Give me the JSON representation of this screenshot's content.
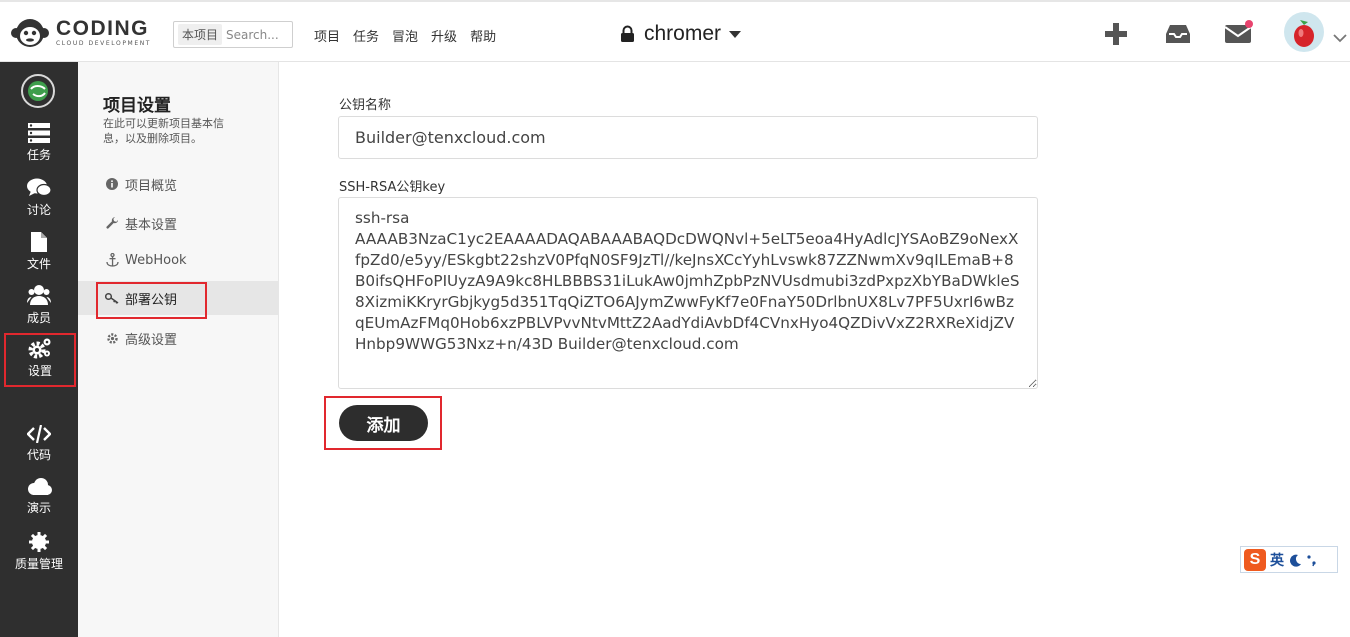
{
  "header": {
    "logo_title": "CODING",
    "logo_subtitle": "CLOUD DEVELOPMENT",
    "search_scope": "本项目",
    "search_placeholder": "Search...",
    "nav": [
      "项目",
      "任务",
      "冒泡",
      "升级",
      "帮助"
    ],
    "project_name": "chromer",
    "icons": [
      "plus-icon",
      "inbox-icon",
      "mail-icon",
      "avatar",
      "chevron-down-icon"
    ]
  },
  "sidebar": {
    "items": [
      {
        "label": "任务",
        "icon": "tasks-icon"
      },
      {
        "label": "讨论",
        "icon": "comments-icon"
      },
      {
        "label": "文件",
        "icon": "file-icon"
      },
      {
        "label": "成员",
        "icon": "users-icon"
      },
      {
        "label": "设置",
        "icon": "gears-icon"
      },
      {
        "label": "代码",
        "icon": "code-icon"
      },
      {
        "label": "演示",
        "icon": "cloud-icon"
      },
      {
        "label": "质量管理",
        "icon": "gear-badge-icon"
      }
    ],
    "active": "设置"
  },
  "settings_nav": {
    "title": "项目设置",
    "description": "在此可以更新项目基本信息，以及删除项目。",
    "items": [
      {
        "label": "项目概览",
        "icon": "info-icon"
      },
      {
        "label": "基本设置",
        "icon": "wrench-icon"
      },
      {
        "label": "WebHook",
        "icon": "anchor-icon"
      },
      {
        "label": "部署公钥",
        "icon": "key-icon"
      },
      {
        "label": "高级设置",
        "icon": "cog-icon"
      }
    ],
    "active": "部署公钥"
  },
  "form": {
    "key_name_label": "公钥名称",
    "key_name_value": "Builder@tenxcloud.com",
    "key_label": "SSH-RSA公钥key",
    "key_value": "ssh-rsa\nAAAAB3NzaC1yc2EAAAADAQABAAABAQDcDWQNvl+5eLT5eoa4HyAdlcJYSAoBZ9oNexXfpZd0/e5yy/ESkgbt22shzV0PfqN0SF9JzTl//keJnsXCcYyhLvswk87ZZNwmXv9qILEmaB+8B0ifsQHFoPIUyzA9A9kc8HLBBBS31iLukAw0jmhZpbPzNVUsdmubi3zdPxpzXbYBaDWkleS8XizmiKKryrGbjkyg5d351TqQiZTO6AJymZwwFyKf7e0FnaY50DrlbnUX8Lv7PF5UxrI6wBzqEUmAzFMq0Hob6xzPBLVPvvNtvMttZ2AadYdiAvbDf4CVnxHyo4QZDivVxZ2RXReXidjZVHnbp9WWG53Nxz+n/43D Builder@tenxcloud.com",
    "submit_label": "添加"
  },
  "ime": {
    "logo": "S",
    "mode": "英"
  }
}
